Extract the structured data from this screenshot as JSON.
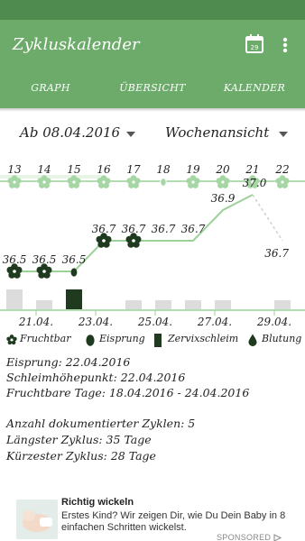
{
  "app": {
    "title": "Zykluskalender",
    "icons": {
      "calendar": "calendar-29-icon",
      "more": "more-vert-icon"
    },
    "calendar_icon_day": "29",
    "colors": {
      "primary": "#6cab6a",
      "status_bar": "#4f8a4e",
      "line": "#9cd19a",
      "bar": "#dcdcdc",
      "event": "#1f3a1f"
    }
  },
  "tabs": [
    {
      "label": "GRAPH",
      "active": true
    },
    {
      "label": "ÜBERSICHT",
      "active": false
    },
    {
      "label": "KALENDER",
      "active": false
    }
  ],
  "filters": {
    "start_date": "Ab 08.04.2016",
    "view_mode": "Wochenansicht"
  },
  "chart_data": {
    "type": "line",
    "day_numbers": [
      "13",
      "14",
      "15",
      "16",
      "17",
      "18",
      "19",
      "20",
      "21",
      "22"
    ],
    "day_markers": [
      "flower",
      "flower",
      "flower",
      "flower",
      "flower",
      "egg",
      "flower",
      "flower",
      "flower",
      "flower"
    ],
    "temperature_labels": [
      "36.5",
      "36.5",
      "36.5",
      "36.7",
      "36.7",
      "36.7",
      "36.7",
      "36.9",
      "37.0",
      "36.7"
    ],
    "temperatures": [
      36.5,
      36.5,
      36.5,
      36.7,
      36.7,
      36.7,
      36.7,
      36.9,
      37.0,
      36.7
    ],
    "point_markers": [
      "flower",
      "flower",
      "egg",
      "flower",
      "flower",
      "none",
      "none",
      "none",
      "none",
      "none"
    ],
    "bars": [
      2,
      1,
      2,
      0,
      1,
      1,
      1,
      1,
      0,
      1
    ],
    "bar_highlight_index": 2,
    "x_tick_labels": [
      "21.04.",
      "23.04.",
      "25.04.",
      "27.04.",
      "29.04."
    ],
    "last_segment_dashed": true
  },
  "legend": [
    {
      "icon": "flower-icon",
      "label": "Fruchtbar"
    },
    {
      "icon": "egg-icon",
      "label": "Eisprung"
    },
    {
      "icon": "mucus-bar-icon",
      "label": "Zervixschleim"
    },
    {
      "icon": "drop-icon",
      "label": "Blutung"
    }
  ],
  "info": {
    "ovulation": "Eisprung: 22.04.2016",
    "mucus_peak": "Schleimhöhepunkt: 22.04.2016",
    "fertile_days": "Fruchtbare Tage: 18.04.2016 - 24.04.2016",
    "cycles_count": "Anzahl dokumentierter Zyklen: 5",
    "longest_cycle": "Längster Zyklus: 35 Tage",
    "shortest_cycle": "Kürzester Zyklus: 28 Tage"
  },
  "ad": {
    "title": "Richtig wickeln",
    "text": "Erstes Kind? Wir zeigen Dir, wie Du Dein Baby in 8 einfachen Schritten wickelst.",
    "sponsored": "SPONSORED"
  }
}
